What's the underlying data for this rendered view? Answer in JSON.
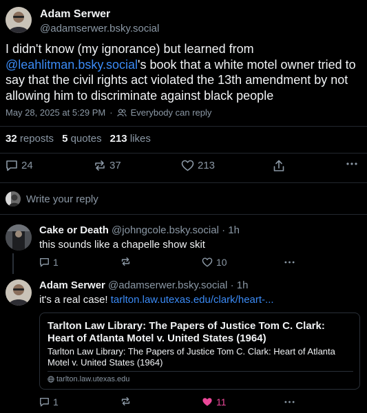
{
  "post": {
    "author_name": "Adam Serwer",
    "author_handle": "@adamserwer.bsky.social",
    "text_part1": "I didn't know (my ignorance) but learned from ",
    "text_mention": "@leahlitman.bsky.social",
    "text_part2": "'s book that a white motel owner tried to say that the civil rights act violated the 13th amendment by not allowing him to discriminate against black people",
    "timestamp": "May 28, 2025 at 5:29 PM",
    "audience": "Everybody can reply",
    "stats": {
      "reposts_count": "32",
      "reposts_label": "reposts",
      "quotes_count": "5",
      "quotes_label": "quotes",
      "likes_count": "213",
      "likes_label": "likes"
    },
    "actions": {
      "reply_count": "24",
      "repost_count": "37",
      "like_count": "213"
    }
  },
  "reply_box": {
    "placeholder": "Write your reply"
  },
  "replies": [
    {
      "author_name": "Cake or Death",
      "author_handle": "@johngcole.bsky.social",
      "time": "· 1h",
      "text": "this sounds like a chapelle show skit",
      "reply_count": "1",
      "like_count": "10",
      "liked": false
    },
    {
      "author_name": "Adam Serwer",
      "author_handle": "@adamserwer.bsky.social",
      "time": "· 1h",
      "text": "it's a real case! ",
      "link_text": "tarlton.law.utexas.edu/clark/heart-...",
      "card": {
        "title": "Tarlton Law Library: The Papers of Justice Tom C. Clark: Heart of Atlanta Motel v. United States (1964)",
        "description": "Tarlton Law Library: The Papers of Justice Tom C. Clark: Heart of Atlanta Motel v. United States (1964)",
        "domain": "tarlton.law.utexas.edu"
      },
      "reply_count": "1",
      "like_count": "11",
      "liked": true
    }
  ],
  "colors": {
    "background": "#000000",
    "text": "#f1f3f5",
    "muted": "#8b98a5",
    "link": "#3b8bf6",
    "liked": "#ec4899"
  }
}
